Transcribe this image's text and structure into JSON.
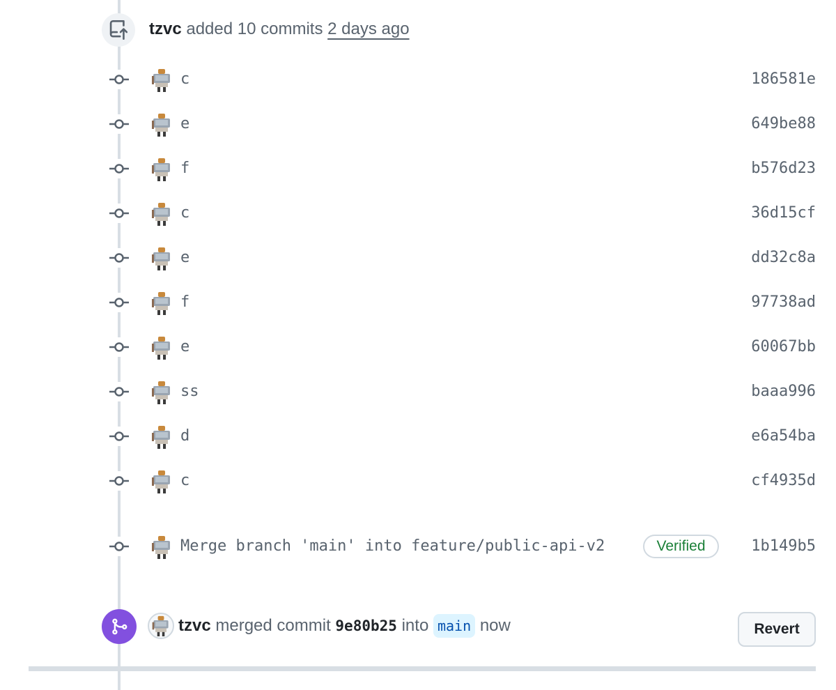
{
  "push_event": {
    "icon": "repo-push-icon",
    "author": "tzvc",
    "action": "added 10 commits",
    "time": "2 days ago"
  },
  "commits": [
    {
      "message": "c",
      "sha": "186581e"
    },
    {
      "message": "e",
      "sha": "649be88"
    },
    {
      "message": "f",
      "sha": "b576d23"
    },
    {
      "message": "c",
      "sha": "36d15cf"
    },
    {
      "message": "e",
      "sha": "dd32c8a"
    },
    {
      "message": "f",
      "sha": "97738ad"
    },
    {
      "message": "e",
      "sha": "60067bb"
    },
    {
      "message": "ss",
      "sha": "baaa996"
    },
    {
      "message": "d",
      "sha": "e6a54ba"
    },
    {
      "message": "c",
      "sha": "cf4935d"
    }
  ],
  "merge_commit_row": {
    "message": "Merge branch 'main' into feature/public-api-v2",
    "verified_label": "Verified",
    "sha": "1b149b5"
  },
  "merge_event": {
    "icon": "git-merge-icon",
    "author": "tzvc",
    "action": "merged commit",
    "commit_sha": "9e80b25",
    "into_label": "into",
    "branch": "main",
    "time": "now",
    "revert_label": "Revert"
  },
  "colors": {
    "merge_badge": "#8250df",
    "verified_text": "#1a7f37",
    "branch_bg": "#ddf4ff",
    "timeline": "#d8dee4"
  }
}
